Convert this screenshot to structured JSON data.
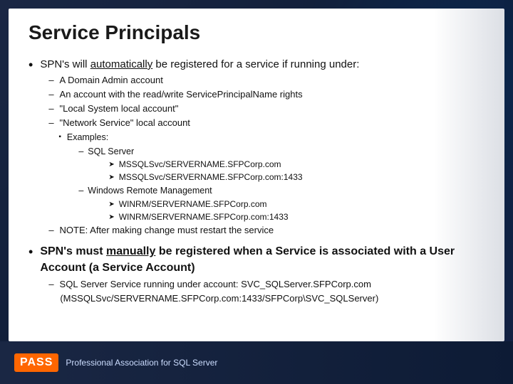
{
  "slide": {
    "title": "Service Principals",
    "bullet1": {
      "prefix": "SPN's will ",
      "underline_word": "automatically",
      "suffix": " be registered for a service if running under:",
      "sub_items": [
        {
          "text": "A ",
          "underline": "Domain Admin account"
        },
        {
          "text": "An account with the read/write ServicePrincipalName rights"
        },
        {
          "text": "\"",
          "underline": "Local System",
          "suffix": " local account\""
        },
        {
          "text": "\"Network Service\" local account"
        }
      ],
      "examples_header": "Examples:",
      "examples": [
        {
          "category": "SQL Server",
          "items": [
            "MSSQLSvc/SERVERNAME.SFPCorp.com",
            "MSSQLSvc/SERVERNAME.SFPCorp.com:1433"
          ]
        },
        {
          "category": "Windows Remote Management",
          "items": [
            "WINRM/SERVERNAME.SFPCorp.com",
            "WINRM/SERVERNAME.SFPCorp.com:1433"
          ]
        }
      ],
      "note_prefix": "NOTE: After making change ",
      "note_underline": "must restart the service"
    },
    "bullet2": {
      "prefix": "SPN's must ",
      "underline_word": "manually",
      "suffix": " be registered when a Service is associated with a User Account (a Service Account)",
      "sub_items": [
        {
          "text": "SQL Server Service running under account: SVC_SQLServer.SFPCorp.com"
        },
        {
          "text": "(MSSQLSvc/SERVERNAME.SFPCorp.com:1433/SFPCorp\\SVC_SQLServer)"
        }
      ]
    }
  },
  "footer": {
    "badge": "PASS",
    "tagline": "Professional Association for SQL Server"
  }
}
